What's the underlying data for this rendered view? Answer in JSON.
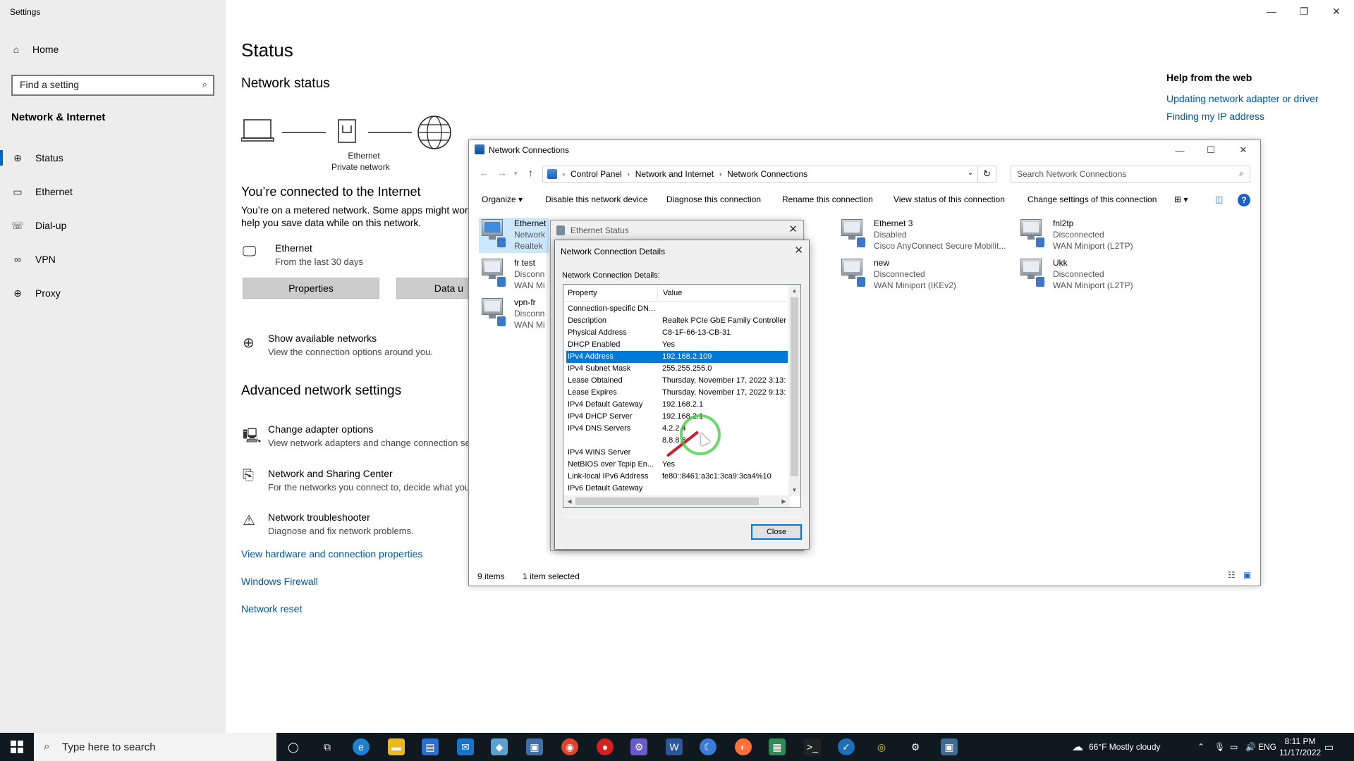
{
  "settings": {
    "app_title": "Settings",
    "home": "Home",
    "search_placeholder": "Find a setting",
    "section": "Network & Internet",
    "nav": [
      {
        "label": "Status",
        "icon": "status-globe-icon"
      },
      {
        "label": "Ethernet",
        "icon": "ethernet-icon"
      },
      {
        "label": "Dial-up",
        "icon": "dialup-icon"
      },
      {
        "label": "VPN",
        "icon": "vpn-icon"
      },
      {
        "label": "Proxy",
        "icon": "proxy-globe-icon"
      }
    ],
    "page_title": "Status",
    "network_status": "Network status",
    "diagram_label_1": "Ethernet",
    "diagram_label_2": "Private network",
    "connected": "You’re connected to the Internet",
    "metered_1": "You’re on a metered network. Some apps might wor",
    "metered_2": "help you save data while on this network.",
    "conn_name": "Ethernet",
    "conn_sub": "From the last 30 days",
    "btn_properties": "Properties",
    "btn_data": "Data u",
    "show_networks": "Show available networks",
    "show_networks_sub": "View the connection options around you.",
    "advanced": "Advanced network settings",
    "change_adapter": "Change adapter options",
    "change_adapter_sub": "View network adapters and change connection se",
    "sharing_center": "Network and Sharing Center",
    "sharing_center_sub": "For the networks you connect to, decide what you",
    "troubleshooter": "Network troubleshooter",
    "troubleshooter_sub": "Diagnose and fix network problems.",
    "link_hw": "View hardware and connection properties",
    "link_firewall": "Windows Firewall",
    "link_reset": "Network reset",
    "help_title": "Help from the web",
    "help_links": [
      "Updating network adapter or driver",
      "Finding my IP address"
    ]
  },
  "netconn": {
    "title": "Network Connections",
    "breadcrumb": [
      "Control Panel",
      "Network and Internet",
      "Network Connections"
    ],
    "search_placeholder": "Search Network Connections",
    "commands": [
      "Organize ▾",
      "Disable this network device",
      "Diagnose this connection",
      "Rename this connection",
      "View status of this connection",
      "Change settings of this connection"
    ],
    "adapters": [
      {
        "name": "Ethernet",
        "status": "Network",
        "device": "Realtek"
      },
      {
        "name": "fr test",
        "status": "Disconn",
        "device": "WAN Mi"
      },
      {
        "name": "vpn-fr",
        "status": "Disconn",
        "device": "WAN Mi"
      },
      {
        "name": "Ethernet 3",
        "status": "Disabled",
        "device": "Cisco AnyConnect Secure Mobilit..."
      },
      {
        "name": "new",
        "status": "Disconnected",
        "device": "WAN Miniport (IKEv2)"
      },
      {
        "name": "fnl2tp",
        "status": "Disconnected",
        "device": "WAN Miniport (L2TP)"
      },
      {
        "name": "Ukk",
        "status": "Disconnected",
        "device": "WAN Miniport (L2TP)"
      }
    ],
    "status_items": "9 items",
    "status_selected": "1 item selected"
  },
  "ethstatus": {
    "title": "Ethernet Status"
  },
  "details": {
    "title": "Network Connection Details",
    "label": "Network Connection Details:",
    "col_property": "Property",
    "col_value": "Value",
    "rows": [
      {
        "k": "Connection-specific DN...",
        "v": ""
      },
      {
        "k": "Description",
        "v": "Realtek PCIe GbE Family Controller"
      },
      {
        "k": "Physical Address",
        "v": "C8-1F-66-13-CB-31"
      },
      {
        "k": "DHCP Enabled",
        "v": "Yes"
      },
      {
        "k": "IPv4 Address",
        "v": "192.168.2.109"
      },
      {
        "k": "IPv4 Subnet Mask",
        "v": "255.255.255.0"
      },
      {
        "k": "Lease Obtained",
        "v": "Thursday, November 17, 2022 3:13:1"
      },
      {
        "k": "Lease Expires",
        "v": "Thursday, November 17, 2022 9:13:1"
      },
      {
        "k": "IPv4 Default Gateway",
        "v": "192.168.2.1"
      },
      {
        "k": "IPv4 DHCP Server",
        "v": "192.168.2.1"
      },
      {
        "k": "IPv4 DNS Servers",
        "v": "4.2.2.4"
      },
      {
        "k": "",
        "v": "8.8.8.8"
      },
      {
        "k": "IPv4 WINS Server",
        "v": ""
      },
      {
        "k": "NetBIOS over Tcpip En...",
        "v": "Yes"
      },
      {
        "k": "Link-local IPv6 Address",
        "v": "fe80::8461:a3c1:3ca9:3ca4%10"
      },
      {
        "k": "IPv6 Default Gateway",
        "v": ""
      }
    ],
    "close": "Close"
  },
  "taskbar": {
    "search_placeholder": "Type here to search",
    "weather": "66°F  Mostly cloudy",
    "lang": "ENG",
    "time": "8:11 PM",
    "date": "11/17/2022"
  }
}
